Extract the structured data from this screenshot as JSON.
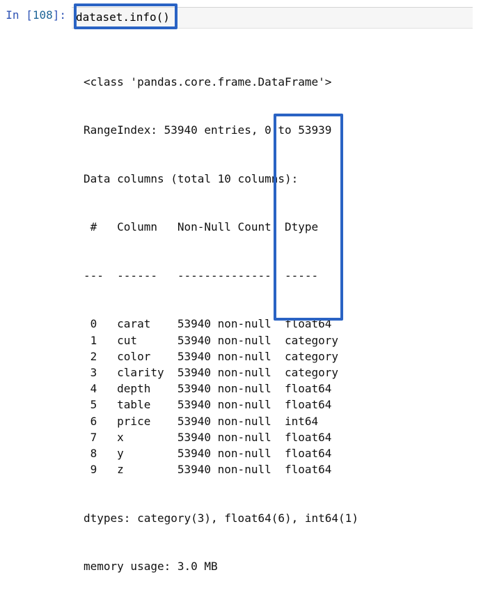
{
  "prompt": {
    "label": "In [",
    "num": "108",
    "close": "]:"
  },
  "code": {
    "text": "dataset.info()"
  },
  "output": {
    "class_line": "<class 'pandas.core.frame.DataFrame'>",
    "range_line": "RangeIndex: 53940 entries, 0 to 53939",
    "cols_line": "Data columns (total 10 columns):",
    "header_line": " #   Column   Non-Null Count  Dtype   ",
    "divider_line": "---  ------   --------------  -----   ",
    "rows": [
      {
        "idx": "0",
        "name": "carat",
        "count": "53940",
        "null": "non-null",
        "dtype": "float64"
      },
      {
        "idx": "1",
        "name": "cut",
        "count": "53940",
        "null": "non-null",
        "dtype": "category"
      },
      {
        "idx": "2",
        "name": "color",
        "count": "53940",
        "null": "non-null",
        "dtype": "category"
      },
      {
        "idx": "3",
        "name": "clarity",
        "count": "53940",
        "null": "non-null",
        "dtype": "category"
      },
      {
        "idx": "4",
        "name": "depth",
        "count": "53940",
        "null": "non-null",
        "dtype": "float64"
      },
      {
        "idx": "5",
        "name": "table",
        "count": "53940",
        "null": "non-null",
        "dtype": "float64"
      },
      {
        "idx": "6",
        "name": "price",
        "count": "53940",
        "null": "non-null",
        "dtype": "int64"
      },
      {
        "idx": "7",
        "name": "x",
        "count": "53940",
        "null": "non-null",
        "dtype": "float64"
      },
      {
        "idx": "8",
        "name": "y",
        "count": "53940",
        "null": "non-null",
        "dtype": "float64"
      },
      {
        "idx": "9",
        "name": "z",
        "count": "53940",
        "null": "non-null",
        "dtype": "float64"
      }
    ],
    "dtypes_line": "dtypes: category(3), float64(6), int64(1)",
    "mem_line": "memory usage: 3.0 MB"
  },
  "highlights": {
    "input_label": "code-highlight",
    "dtype_label": "dtype-column-highlight"
  }
}
